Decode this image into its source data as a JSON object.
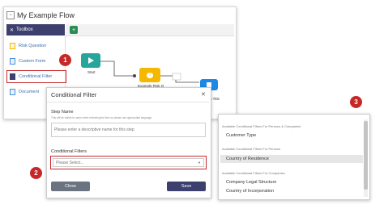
{
  "flow": {
    "title": "My Example Flow",
    "toolbox": {
      "header": "Toolbox",
      "items": [
        {
          "label": "Risk Question"
        },
        {
          "label": "Custom Form"
        },
        {
          "label": "Conditional Filter"
        },
        {
          "label": "Document"
        }
      ]
    },
    "nodes": {
      "start": "Start",
      "example": "Example Risk Q",
      "doc_partial": "n Title"
    }
  },
  "modal": {
    "title": "Conditional Filter",
    "step_name_label": "Step Name",
    "step_name_hint": "This will be visible to users when reviewing the flow so please use appropriate language.",
    "step_name_placeholder": "Please enter a descriptive name for this step",
    "filters_label": "Conditional Filters",
    "filters_placeholder": "Please Select...",
    "close_label": "Close",
    "save_label": "Save"
  },
  "dropdown": {
    "groups": [
      {
        "header": "Available Conditional Filters For Persons & Companies",
        "items": [
          "Customer Type"
        ]
      },
      {
        "header": "Available Conditional Filters For Persons",
        "items": [
          "Country of Residence"
        ]
      },
      {
        "header": "Available Conditional Filters For Companies",
        "items": [
          "Company Legal Structure",
          "Country of Incorporation"
        ]
      }
    ]
  },
  "callouts": {
    "one": "1",
    "two": "2",
    "three": "3"
  },
  "colors": {
    "callout": "#c62828",
    "toolbox": "#3d3f6e",
    "start_node": "#26a69a",
    "risk_node": "#f5b800",
    "doc_node": "#1e88e5"
  }
}
